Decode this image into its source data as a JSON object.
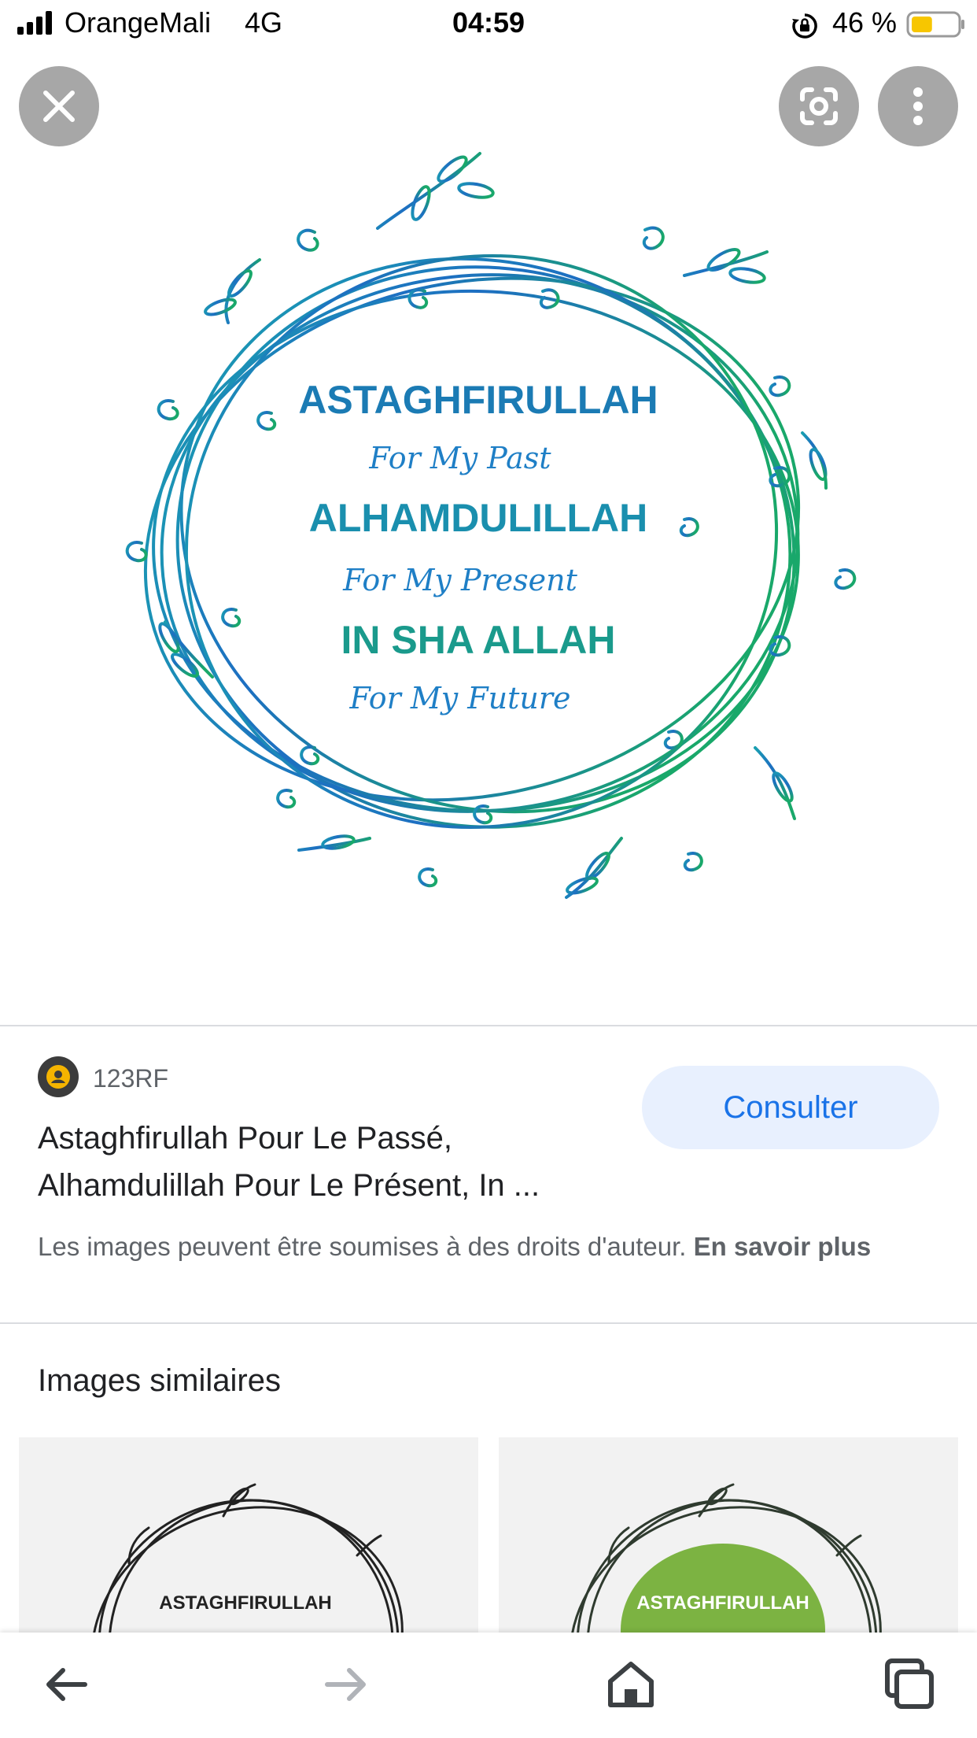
{
  "status_bar": {
    "carrier": "OrangeMali",
    "network": "4G",
    "time": "04:59",
    "battery": "46 %",
    "battery_level": 0.46
  },
  "image_text": {
    "line1": "ASTAGHFIRULLAH",
    "line2": "For My Past",
    "line3": "ALHAMDULILLAH",
    "line4": "For My Present",
    "line5": "IN SHA ALLAH",
    "line6": "For My Future"
  },
  "source": {
    "name": "123RF",
    "title": "Astaghfirullah Pour Le Passé, Alhamdulillah Pour Le Présent, In ...",
    "consult_label": "Consulter"
  },
  "copyright": {
    "text": "Les images peuvent être soumises à des droits d'auteur. ",
    "link_label": "En savoir plus"
  },
  "similar": {
    "heading": "Images similaires",
    "thumb1_text": "ASTAGHFIRULLAH",
    "thumb2_text": "ASTAGHFIRULLAH"
  },
  "colors": {
    "accent_blue": "#1a73e8",
    "button_bg": "#e8f0fe",
    "overlay_button": "#a7a7a7",
    "battery_yellow": "#f7c600",
    "text_blue": "#1f78b4",
    "text_teal": "#1a9a8c",
    "thumb_green": "#7cb342"
  },
  "icons": {
    "close": "close-icon",
    "lens": "lens-icon",
    "more": "more-vert-icon",
    "back": "arrow-back-icon",
    "forward": "arrow-forward-icon",
    "home": "home-icon",
    "tabs": "tabs-icon"
  }
}
